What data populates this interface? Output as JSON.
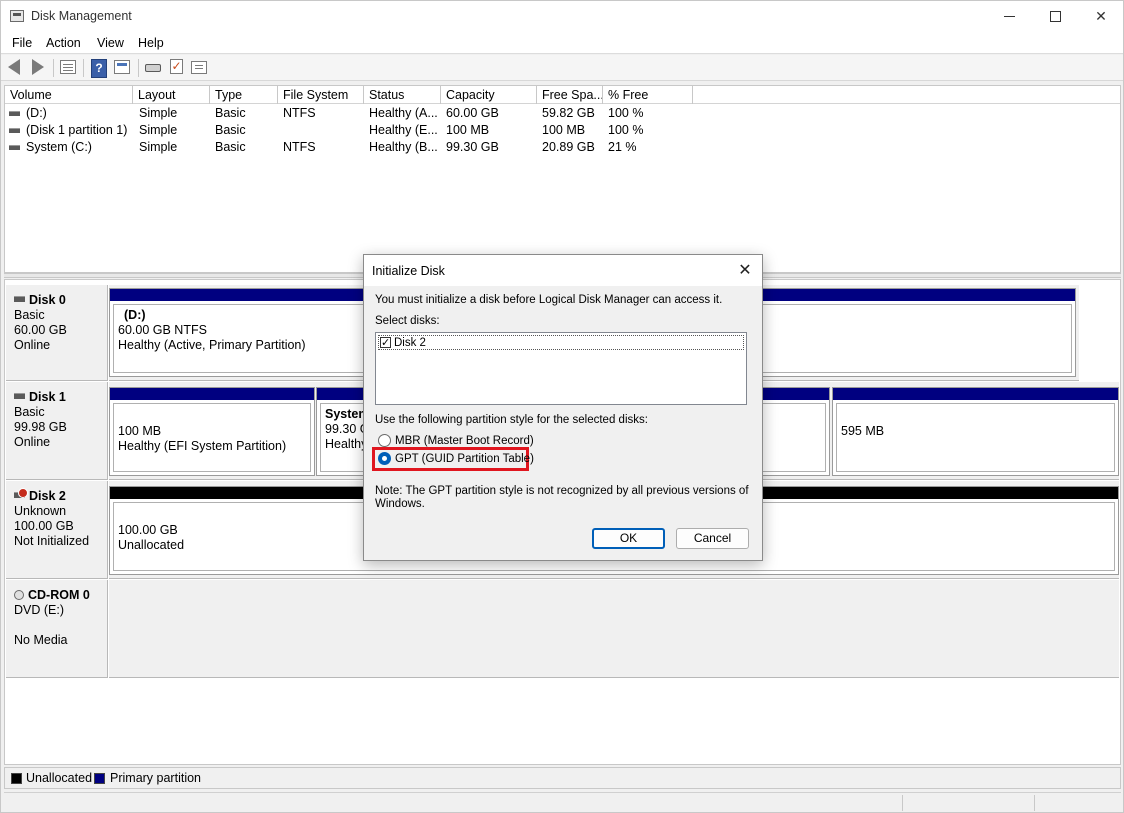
{
  "window": {
    "title": "Disk Management"
  },
  "menu": [
    "File",
    "Action",
    "View",
    "Help"
  ],
  "toolbar": {
    "buttons": [
      "back-icon",
      "forward-icon",
      "list-view-icon",
      "help-icon",
      "properties-icon",
      "connect-icon",
      "checklist-icon",
      "sheet-icon"
    ]
  },
  "volume_list": {
    "columns": [
      "Volume",
      "Layout",
      "Type",
      "File System",
      "Status",
      "Capacity",
      "Free Spa...",
      "% Free"
    ],
    "rows": [
      [
        "(D:)",
        "Simple",
        "Basic",
        "NTFS",
        "Healthy (A...",
        "60.00 GB",
        "59.82 GB",
        "100 %"
      ],
      [
        "(Disk 1 partition 1)",
        "Simple",
        "Basic",
        "",
        "Healthy (E...",
        "100 MB",
        "100 MB",
        "100 %"
      ],
      [
        "System (C:)",
        "Simple",
        "Basic",
        "NTFS",
        "Healthy (B...",
        "99.30 GB",
        "20.89 GB",
        "21 %"
      ]
    ]
  },
  "disks": [
    {
      "name": "Disk 0",
      "type": "Basic",
      "size": "60.00 GB",
      "state": "Online",
      "partitions": [
        {
          "title": "(D:)",
          "line1": "60.00 GB NTFS",
          "line2": "Healthy (Active, Primary Partition)"
        }
      ]
    },
    {
      "name": "Disk 1",
      "type": "Basic",
      "size": "99.98 GB",
      "state": "Online",
      "partitions": [
        {
          "title": "",
          "line1": "100 MB",
          "line2": "Healthy (EFI System Partition)"
        },
        {
          "title": "System",
          "line1": "99.30 GB",
          "line2": "Healthy"
        },
        {
          "title": "",
          "line1": "595 MB",
          "line2": ""
        }
      ]
    },
    {
      "name": "Disk 2",
      "type": "Unknown",
      "size": "100.00 GB",
      "state": "Not Initialized",
      "partitions": [
        {
          "title": "",
          "line1": "100.00 GB",
          "line2": "Unallocated"
        }
      ]
    },
    {
      "name": "CD-ROM 0",
      "type": "DVD (E:)",
      "size": "",
      "state": "No Media"
    }
  ],
  "legend": [
    {
      "label": "Unallocated",
      "color": "#000000"
    },
    {
      "label": "Primary partition",
      "color": "#000080"
    }
  ],
  "dialog": {
    "title": "Initialize Disk",
    "intro": "You must initialize a disk before Logical Disk Manager can access it.",
    "select_label": "Select disks:",
    "disk_items": [
      {
        "label": "Disk 2",
        "checked": true
      }
    ],
    "style_label": "Use the following partition style for the selected disks:",
    "options": [
      {
        "label": "MBR (Master Boot Record)",
        "selected": false
      },
      {
        "label": "GPT (GUID Partition Table)",
        "selected": true
      }
    ],
    "note_line1": "Note: The GPT partition style is not recognized by all previous versions of",
    "note_line2": "Windows.",
    "ok_label": "OK",
    "cancel_label": "Cancel"
  },
  "colors": {
    "primary_partition": "#000080",
    "unallocated": "#000000",
    "highlight": "#e0161f",
    "accent": "#005fb8"
  }
}
